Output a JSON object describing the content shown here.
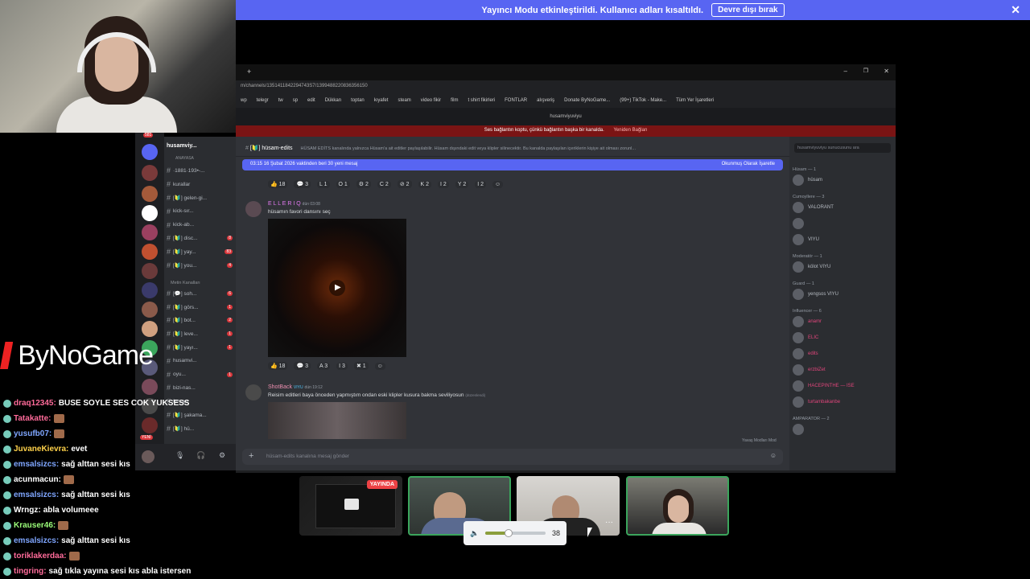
{
  "banner": {
    "text": "Yayıncı Modu etkinleştirildi. Kullanıcı adları kısaltıldı.",
    "button": "Devre dışı bırak"
  },
  "browser": {
    "url": "m/channels/1351411842294743S7/1399488220836356150",
    "bookmarks": [
      "wp",
      "telegr",
      "tw",
      "sp",
      "edit",
      "Dükkan",
      "toptan",
      "kıyafet",
      "steam",
      "video fikir",
      "film",
      "t shirt fikirleri",
      "FONTLAR",
      "alışveriş",
      "Donate ByNoGame...",
      "(99+) TikTok - Make...",
      "Tüm Yer İşaretleri"
    ],
    "title": "husamviyuviyu",
    "warning": "Ses bağlantın koptu, çünkü bağlantın başka bir kanalda.",
    "warning_action": "Yeniden Bağlan"
  },
  "server": {
    "name": "husamviy...",
    "section_anayasa": "ANAYASA",
    "section_metin": "Metin Kanalları"
  },
  "channels": [
    {
      "name": "·1881·193•-...",
      "badge": ""
    },
    {
      "name": "kurallar",
      "badge": ""
    },
    {
      "name": "[🔰] gelen-gi...",
      "badge": ""
    },
    {
      "name": "kick-sır...",
      "badge": ""
    },
    {
      "name": "kick-ab...",
      "badge": ""
    },
    {
      "name": "[🔰] disc...",
      "badge": "8"
    },
    {
      "name": "[🔰] yay...",
      "badge": "83"
    },
    {
      "name": "[🔰] you...",
      "badge": "4"
    },
    {
      "name": "[💬] soh...",
      "badge": "6"
    },
    {
      "name": "[🔰] görs...",
      "badge": "1"
    },
    {
      "name": "[🔰] bot...",
      "badge": "2"
    },
    {
      "name": "[🔰] leve...",
      "badge": "1"
    },
    {
      "name": "[🔰] yayı...",
      "badge": "1"
    },
    {
      "name": "husamvi...",
      "badge": ""
    },
    {
      "name": "oyu...",
      "badge": "1"
    },
    {
      "name": "bizi-nas...",
      "badge": ""
    },
    {
      "name": "fun-art",
      "badge": ""
    },
    {
      "name": "[🔰] şakama...",
      "badge": ""
    },
    {
      "name": "[🔰] hü...",
      "badge": ""
    }
  ],
  "channel_header": {
    "name": "[🔰] hüsam-edits",
    "topic": "HÜSAM EDİTS kanalında yalnızca Hüsam'a ait editler paylaşılabilir. Hüsam dışındaki edit veya klipler silinecektir. Bu kanalda paylaşılan içeriklerin kişiye ait olması zorunl..."
  },
  "new_messages": {
    "text": "03:15 16 Şubat 2026 vaktinden beri 30 yeni mesaj",
    "action": "Okunmuş Olarak İşaretle"
  },
  "reactions1": [
    "👍 18",
    "💬 3",
    "L 1",
    "O 1",
    "⚙ 2",
    "C 2",
    "⊘ 2",
    "K 2",
    "I 2",
    "Y 2",
    "I 2"
  ],
  "message1": {
    "author": "E L L E R I Q",
    "time": "dün 03:08",
    "text": "hüsamın favori dansını seç"
  },
  "reactions2": [
    "👍 18",
    "💬 3",
    "A 3",
    "I 3",
    "✖ 1"
  ],
  "message2": {
    "author": "ShotBack",
    "tag": "VIYU",
    "time": "dün 19:12",
    "text": "Reisim editleri baya önceden yapmıştım ondan eski klipler kusura bakma seviliyosun",
    "edited": "(düzenlendi)"
  },
  "composer": {
    "placeholder": "hüsam-edits kanalına mesaj gönder",
    "slowmode": "Yavaş Modları Mod"
  },
  "members": {
    "search": "husamviyuviyu sunucusunu ara",
    "groups": [
      {
        "title": "Hüsam — 1",
        "items": [
          "hüsam"
        ]
      },
      {
        "title": "Cumoyllere — 3",
        "items": [
          "VALORANT",
          "",
          "VIYU"
        ]
      },
      {
        "title": "Moderatör — 1",
        "items": [
          "kölot VIYU"
        ]
      },
      {
        "title": "Guard — 1",
        "items": [
          "yengsos VIYU"
        ]
      },
      {
        "title": "Influencer — 6",
        "items": [
          "anamr",
          "ELIC",
          "edits",
          "erzbiZet",
          "HACEPINTHE — ISE",
          "turtambakanbe"
        ]
      },
      {
        "title": "AMPARATOR — 2",
        "items": [
          ""
        ]
      }
    ]
  },
  "stream_logo": "ByNoGame",
  "chat": [
    {
      "user": "draq12345:",
      "msg": "BUSE SOYLE SES COK YUKSESS",
      "color": "#ff6b9a"
    },
    {
      "user": "Tatakatte:",
      "msg": "",
      "color": "#ff6b9a"
    },
    {
      "user": "yusufb07:",
      "msg": "",
      "color": "#7fa6ff"
    },
    {
      "user": "JuvaneKievra:",
      "msg": "evet",
      "color": "#ffd24a"
    },
    {
      "user": "emsalsizcs:",
      "msg": "sağ alttan sesi kıs",
      "color": "#7fa6ff"
    },
    {
      "user": "acunmacun:",
      "msg": "",
      "color": "#ffffff"
    },
    {
      "user": "emsalsizcs:",
      "msg": "sağ alttan sesi kıs",
      "color": "#7fa6ff"
    },
    {
      "user": "Wrngz:",
      "msg": "abla volumeee",
      "color": "#ffffff"
    },
    {
      "user": "Krauser46:",
      "msg": "",
      "color": "#9cff7a"
    },
    {
      "user": "emsalsizcs:",
      "msg": "sağ alttan sesi kıs",
      "color": "#7fa6ff"
    },
    {
      "user": "toriklakerdaa:",
      "msg": "",
      "color": "#ff6b9a"
    },
    {
      "user": "tingring:",
      "msg": "sağ tıkla yayına sesi kıs abla istersen",
      "color": "#ff6b9a"
    }
  ],
  "live_label": "YAYINDA",
  "volume": {
    "value": "38",
    "level": 0.38
  },
  "guild_badges": {
    "top": "581",
    "new": "YENİ"
  },
  "colors": {
    "accent": "#5865f2",
    "live": "#ed4245",
    "speaking": "#3ba55c"
  }
}
